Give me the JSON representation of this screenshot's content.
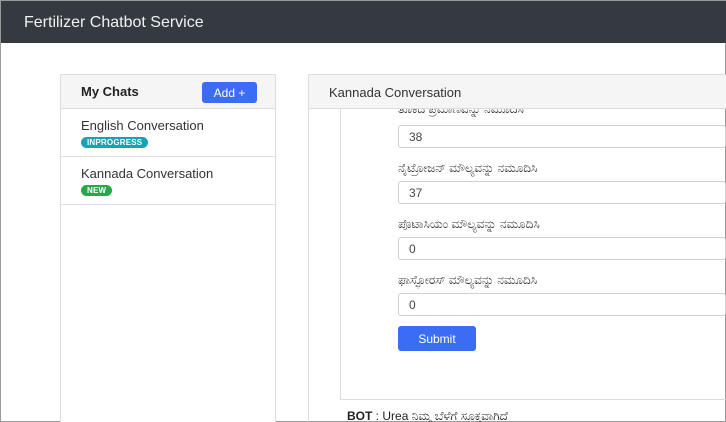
{
  "app": {
    "title": "Fertilizer Chatbot Service"
  },
  "sidebar": {
    "title": "My Chats",
    "add_label": "Add +",
    "chats": [
      {
        "name": "English Conversation",
        "status": "INPROGRESS",
        "status_color": "#18a2b8"
      },
      {
        "name": "Kannada Conversation",
        "status": "NEW",
        "status_color": "#27a745"
      }
    ]
  },
  "conversation": {
    "title": "Kannada Conversation",
    "fields": [
      {
        "label": "ತೂಕದ ಪ್ರಮಾಣವನ್ನು ನಮೂದಿಸಿ",
        "value": "38"
      },
      {
        "label": "ನೈಟ್ರೋಜನ್ ಮೌಲ್ಯವನ್ನು ನಮೂದಿಸಿ",
        "value": "37"
      },
      {
        "label": "ಪೊಟಾಸಿಯಂ ಮೌಲ್ಯವನ್ನು ನಮೂದಿಸಿ",
        "value": "0"
      },
      {
        "label": "ಫಾಸ್ಫೋರಸ್ ಮೌಲ್ಯವನ್ನು ನಮೂದಿಸಿ",
        "value": "0"
      }
    ],
    "submit_label": "Submit",
    "bot_message": {
      "sender": "BOT",
      "separator": " : ",
      "text": "Urea ನಿಮ್ಮ ಬೆಳೆಗೆ ಸೂಕ್ತವಾಗಿದೆ"
    }
  },
  "colors": {
    "navbar": "#343a40",
    "primary": "#3b6cf4",
    "inprogress": "#18a2b8",
    "new": "#27a745"
  }
}
